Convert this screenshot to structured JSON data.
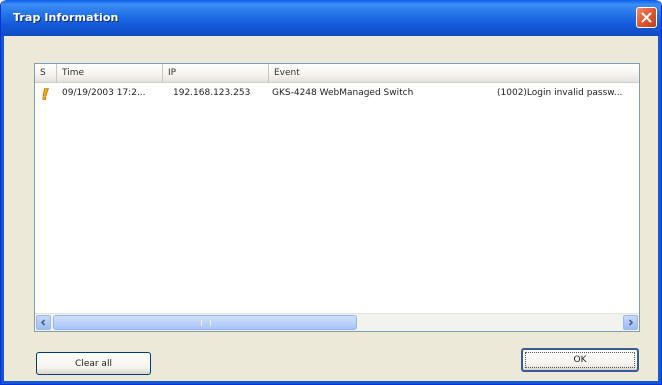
{
  "window": {
    "title": "Trap Information"
  },
  "list": {
    "columns": [
      {
        "key": "severity",
        "label": "S"
      },
      {
        "key": "time",
        "label": "Time"
      },
      {
        "key": "ip",
        "label": "IP"
      },
      {
        "key": "event",
        "label": "Event"
      }
    ],
    "rows": [
      {
        "severity_icon": "warning-icon",
        "time": "09/19/2003 17:2...",
        "ip": "192.168.123.253",
        "event": "GKS-4248 WebManaged Switch",
        "detail": "(1002)Login invalid passw..."
      }
    ]
  },
  "buttons": {
    "clear_all": "Clear all",
    "ok": "OK"
  },
  "colors": {
    "titlebar": "#1458d8",
    "warning": "#f5a800",
    "close": "#e0562f"
  }
}
